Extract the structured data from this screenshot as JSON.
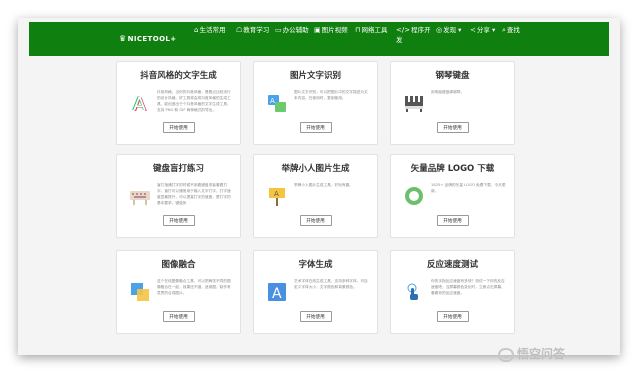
{
  "header": {
    "logo": "NICETOOL+",
    "nav": [
      {
        "icon": "home-icon",
        "glyph": "⌂",
        "label": "生活常用"
      },
      {
        "icon": "graduation-cap-icon",
        "glyph": "☖",
        "label": "教育学习"
      },
      {
        "icon": "briefcase-icon",
        "glyph": "▭",
        "label": "办公辅助"
      },
      {
        "icon": "image-icon",
        "glyph": "▣",
        "label": "图片视频"
      },
      {
        "icon": "network-icon",
        "glyph": "⊓",
        "label": "网络工具"
      },
      {
        "icon": "code-icon",
        "glyph": "</>",
        "label": "程序开发"
      },
      {
        "icon": "compass-icon",
        "glyph": "◎",
        "label": "发现 ▾"
      },
      {
        "icon": "share-icon",
        "glyph": "≺",
        "label": "分享 ▾"
      },
      {
        "icon": "search-icon",
        "glyph": "⌕",
        "label": "查找"
      }
    ]
  },
  "cards": [
    {
      "title": "抖音风格的文字生成",
      "desc": "抖音风格，当你的抖音风格，蓬着点比较流行的设计风格。好工具将会将抖音风格的生成工具，能创造出于个抖音风格的文字生成工具，支持 PNG 和 GIF 两种格式的导出。",
      "button": "开始使用",
      "icon": "letter-a-glitch-icon"
    },
    {
      "title": "图片文字识别",
      "desc": "图片文字识别，可以把图片中的文字描述为文本内容，在使用时，复制使用。",
      "button": "开始使用",
      "icon": "image-text-ocr-icon"
    },
    {
      "title": "钢琴键盘",
      "desc": "用电脑键盘弹钢琴。",
      "button": "开始使用",
      "icon": "piano-icon"
    },
    {
      "title": "键盘盲打练习",
      "desc": "盲打指通打字的时候不用看键盘或者看着打字。盲打可以通常用于输入文字打字，打字速度显著提升，可以提高打字的速度，是打字的基本要求。键盘所",
      "button": "开始使用",
      "icon": "keyboard-icon"
    },
    {
      "title": "举牌小人图片生成",
      "desc": "举牌小人图片生成工具，好玩有趣。",
      "button": "开始使用",
      "icon": "sign-holding-person-icon"
    },
    {
      "title": "矢量品牌 LOGO 下载",
      "desc": "1825+ 品牌的矢量 LOGO 免费下载，今天更新。",
      "button": "开始使用",
      "icon": "ring-logo-icon"
    },
    {
      "title": "图像融合",
      "desc": "这个在线图像融合工具，可以把两张不同的图像融合在一起，效果还不错。适用图，制作有意思的合成图片。",
      "button": "开始使用",
      "icon": "image-blend-icon"
    },
    {
      "title": "字体生成",
      "desc": "艺术字体在线生成工具，支持多种字体，可自定义字体大小，文字颜色和背景颜色。",
      "button": "开始使用",
      "icon": "font-a-icon"
    },
    {
      "title": "反应速度测试",
      "desc": "你的手指反应速度有多快？测试一下你的反应速度吧，当屏幕颜色变化时，立即点击屏幕，看看你的反应速度。",
      "button": "开始使用",
      "icon": "tap-finger-icon"
    }
  ],
  "watermark": "悟空问答",
  "colors": {
    "nav_bg": "#0f7f0f",
    "frame_bg": "#f4f4f4"
  }
}
